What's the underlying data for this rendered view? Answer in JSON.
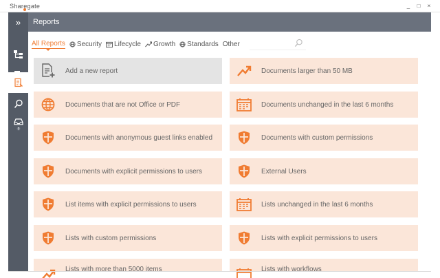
{
  "app": {
    "name": "Sharegate",
    "controls": [
      "_",
      "□",
      "×"
    ]
  },
  "sidebar": {
    "toggle": "»"
  },
  "header": {
    "title": "Reports"
  },
  "tabs": [
    {
      "label": "All Reports",
      "icon": "none"
    },
    {
      "label": "Security",
      "icon": "shield-icon"
    },
    {
      "label": "Lifecycle",
      "icon": "calendar-icon"
    },
    {
      "label": "Growth",
      "icon": "trend-icon"
    },
    {
      "label": "Standards",
      "icon": "globe-icon"
    },
    {
      "label": "Other",
      "icon": "none"
    }
  ],
  "search": {
    "placeholder": ""
  },
  "reports": [
    {
      "label": "Add a new report",
      "icon": "add-report-icon"
    },
    {
      "label": "Documents larger than 50 MB",
      "icon": "trend-up-icon"
    },
    {
      "label": "Documents that are not Office or PDF",
      "icon": "globe-icon"
    },
    {
      "label": "Documents unchanged in the last 6 months",
      "icon": "calendar-icon"
    },
    {
      "label": "Documents with anonymous guest links enabled",
      "icon": "shield-icon"
    },
    {
      "label": "Documents with custom permissions",
      "icon": "shield-icon"
    },
    {
      "label": "Documents with explicit permissions to users",
      "icon": "shield-icon"
    },
    {
      "label": "External Users",
      "icon": "shield-icon"
    },
    {
      "label": "List items with explicit permissions to users",
      "icon": "shield-icon"
    },
    {
      "label": "Lists unchanged in the last 6 months",
      "icon": "calendar-icon"
    },
    {
      "label": "Lists with custom permissions",
      "icon": "shield-icon"
    },
    {
      "label": "Lists with explicit permissions to users",
      "icon": "shield-icon"
    },
    {
      "label": "Lists with more than 5000 items",
      "icon": "trend-up-icon"
    },
    {
      "label": "Lists with workflows",
      "icon": "calendar-icon"
    }
  ],
  "colors": {
    "accent": "#f07c32",
    "card": "#fbe6d9",
    "sidebar": "#545b66",
    "header": "#6a717d"
  }
}
